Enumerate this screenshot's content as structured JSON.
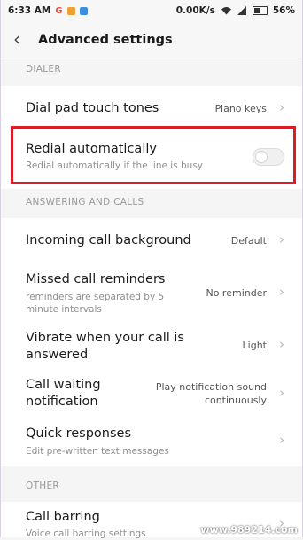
{
  "statusbar": {
    "time": "6:33 AM",
    "net_speed": "0.00K/s",
    "battery": "56%",
    "icons": [
      "gmail-icon",
      "notification-icon",
      "notification-icon",
      "wifi-icon",
      "signal-icon",
      "battery-icon"
    ]
  },
  "header": {
    "title": "Advanced settings",
    "back_icon": "back-arrow-icon"
  },
  "sections": {
    "dialer": "DIALER",
    "answering": "ANSWERING AND CALLS",
    "other": "OTHER"
  },
  "rows": {
    "dial_pad": {
      "title": "Dial pad touch tones",
      "value": "Piano keys"
    },
    "redial": {
      "title": "Redial automatically",
      "subtitle": "Redial automatically if the line is busy",
      "toggle_on": false
    },
    "incoming_bg": {
      "title": "Incoming call background",
      "value": "Default"
    },
    "missed": {
      "title": "Missed call reminders",
      "subtitle_1": "reminders are separated by 5",
      "subtitle_2": "minute intervals",
      "value": "No reminder"
    },
    "vibrate": {
      "title_1": "Vibrate when your call is",
      "title_2": "answered",
      "value": "Light"
    },
    "call_waiting": {
      "title_1": "Call waiting",
      "title_2": "notification",
      "value_1": "Play notification sound",
      "value_2": "continuously"
    },
    "quick": {
      "title": "Quick responses",
      "subtitle": "Edit pre-written text messages"
    },
    "barring": {
      "title": "Call barring",
      "subtitle": "Voice call barring settings"
    }
  },
  "colors": {
    "highlight": "#e01b24",
    "background": "#f5f5f5"
  },
  "watermark": "www.989214.com"
}
